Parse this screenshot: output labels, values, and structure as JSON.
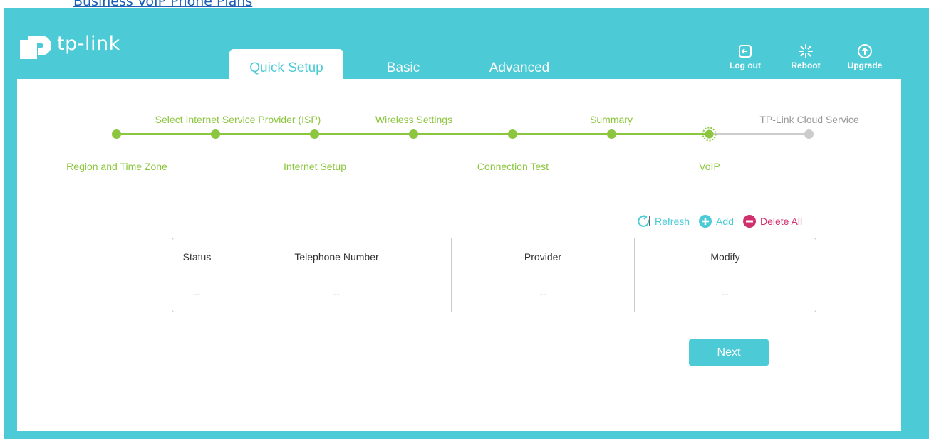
{
  "link_text": "Business VoIP Phone Plans",
  "brand": {
    "name": "tp-link"
  },
  "tabs": [
    {
      "label": "Quick Setup",
      "active": true
    },
    {
      "label": "Basic",
      "active": false
    },
    {
      "label": "Advanced",
      "active": false
    }
  ],
  "toolbar": {
    "logout": {
      "label": "Log out",
      "icon": "logout-icon"
    },
    "reboot": {
      "label": "Reboot",
      "icon": "reboot-icon"
    },
    "upgrade": {
      "label": "Upgrade",
      "icon": "upgrade-icon"
    }
  },
  "steps": [
    {
      "label": "Region and Time Zone",
      "state": "done"
    },
    {
      "label": "Select Internet Service Provider (ISP)",
      "state": "done"
    },
    {
      "label": "Internet Setup",
      "state": "done"
    },
    {
      "label": "Wireless Settings",
      "state": "done"
    },
    {
      "label": "Connection Test",
      "state": "done"
    },
    {
      "label": "Summary",
      "state": "done"
    },
    {
      "label": "VoIP",
      "state": "current"
    },
    {
      "label": "TP-Link Cloud Service",
      "state": "future"
    }
  ],
  "table_actions": {
    "refresh": "Refresh",
    "add": "Add",
    "delete_all": "Delete All"
  },
  "table": {
    "headers": [
      "Status",
      "Telephone Number",
      "Provider",
      "Modify"
    ],
    "rows": [
      [
        "--",
        "--",
        "--",
        "--"
      ]
    ]
  },
  "next_label": "Next",
  "colors": {
    "brand": "#4ccbd6",
    "step_done": "#8cc63e",
    "step_future": "#cccccc",
    "delete": "#d0306e"
  }
}
